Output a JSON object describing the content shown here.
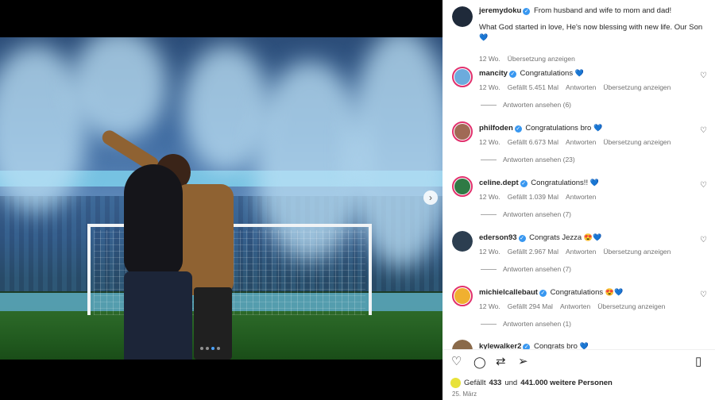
{
  "post": {
    "author": "jeremydoku",
    "caption_line1": "From husband and wife to mom and dad!",
    "caption_body": "What God started in love, He's now blessing with new life. Our Son",
    "caption_emoji": "💙",
    "age": "12 Wo.",
    "translate_label": "Übersetzung anzeigen"
  },
  "comments": [
    {
      "user": "mancity",
      "text": "Congratulations",
      "emoji": "💙",
      "age": "12 Wo.",
      "likes": "Gefällt 5.451 Mal",
      "reply": "Antworten",
      "translate": "Übersetzung anzeigen",
      "view_replies": "Antworten ansehen (6)",
      "avatar_color": "#6cabdd"
    },
    {
      "user": "philfoden",
      "text": "Congratulations bro",
      "emoji": "💙",
      "age": "12 Wo.",
      "likes": "Gefällt 6.673 Mal",
      "reply": "Antworten",
      "translate": "Übersetzung anzeigen",
      "view_replies": "Antworten ansehen (23)",
      "avatar_color": "#a06a55"
    },
    {
      "user": "celine.dept",
      "text": "Congratulations!!",
      "emoji": "💙",
      "age": "12 Wo.",
      "likes": "Gefällt 1.039 Mal",
      "reply": "Antworten",
      "translate": "",
      "view_replies": "Antworten ansehen (7)",
      "avatar_color": "#2f7a45"
    },
    {
      "user": "ederson93",
      "text": "Congrats Jezza",
      "emoji": "😍💙",
      "age": "12 Wo.",
      "likes": "Gefällt 2.967 Mal",
      "reply": "Antworten",
      "translate": "Übersetzung anzeigen",
      "view_replies": "Antworten ansehen (7)",
      "avatar_color": "#2c3e50"
    },
    {
      "user": "michielcallebaut",
      "text": "Congratulations",
      "emoji": "😍💙",
      "age": "12 Wo.",
      "likes": "Gefällt 294 Mal",
      "reply": "Antworten",
      "translate": "Übersetzung anzeigen",
      "view_replies": "Antworten ansehen (1)",
      "avatar_color": "#f0b030"
    }
  ],
  "partial_comment": {
    "user": "kylewalker2",
    "text": "Congrats bro",
    "emoji": "💙"
  },
  "footer": {
    "liked_prefix": "Gefällt",
    "liked_count": "433",
    "liked_mid": "und",
    "liked_total": "441.000 weitere Personen",
    "date": "25. März"
  },
  "icons": {
    "like": "heart-outline-icon",
    "comment": "comment-bubble-icon",
    "repost": "repost-icon",
    "share": "paper-plane-icon",
    "save": "bookmark-icon",
    "next": "chevron-right-icon"
  }
}
